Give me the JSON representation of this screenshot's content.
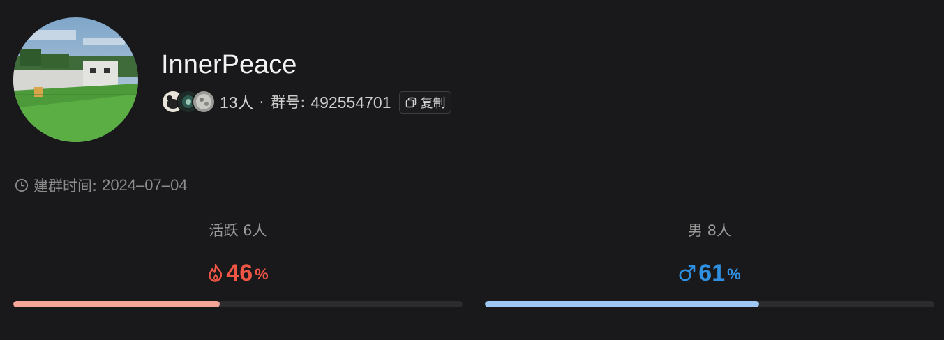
{
  "group": {
    "name": "InnerPeace",
    "member_count": "13人",
    "separator": "·",
    "id_label": "群号:",
    "id_value": "492554701",
    "copy_label": "复制"
  },
  "created": {
    "label": "建群时间:",
    "date": "2024–07–04"
  },
  "stats": {
    "active": {
      "label": "活跃 6人",
      "value": "46",
      "unit": "%",
      "percent": 46,
      "icon": "flame-icon",
      "color": "#ef5545"
    },
    "male": {
      "label": "男 8人",
      "value": "61",
      "unit": "%",
      "percent": 61,
      "icon": "male-icon",
      "color": "#2f8fe0"
    }
  }
}
